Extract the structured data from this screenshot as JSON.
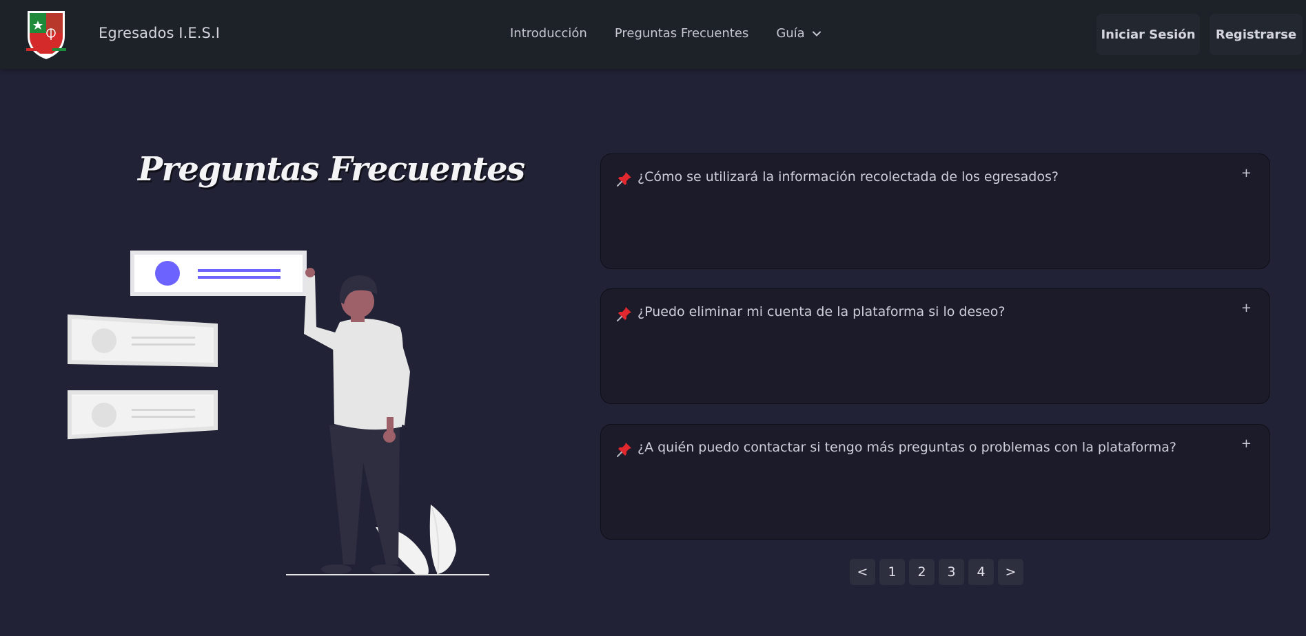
{
  "navbar": {
    "brand": "Egresados I.E.S.I",
    "logo_icon": "school-shield-icon",
    "links": [
      {
        "label": "Introducción"
      },
      {
        "label": "Preguntas Frecuentes"
      },
      {
        "label": "Guía",
        "icon": "chevron-down-icon"
      }
    ],
    "login_label": "Iniciar Sesión",
    "register_label": "Registrarse"
  },
  "hero": {
    "title": "Preguntas Frecuentes",
    "illustration_icon": "person-with-cards-illustration"
  },
  "faq": {
    "items": [
      {
        "question": "¿Cómo se utilizará la información recolectada de los egresados?",
        "toggle": "+",
        "icon": "pushpin-icon"
      },
      {
        "question": "¿Puedo eliminar mi cuenta de la plataforma si lo deseo?",
        "toggle": "+",
        "icon": "pushpin-icon"
      },
      {
        "question": "¿A quién puedo contactar si tengo más preguntas o problemas con la plataforma?",
        "toggle": "+",
        "icon": "pushpin-icon"
      }
    ]
  },
  "pagination": {
    "prev": "<",
    "pages": [
      "1",
      "2",
      "3",
      "4"
    ],
    "next": ">"
  },
  "colors": {
    "background": "#222236",
    "navbar": "#1d2128",
    "card": "#1b1b2a",
    "accent_purple": "#6c63ff",
    "pin_red": "#e0282e"
  }
}
